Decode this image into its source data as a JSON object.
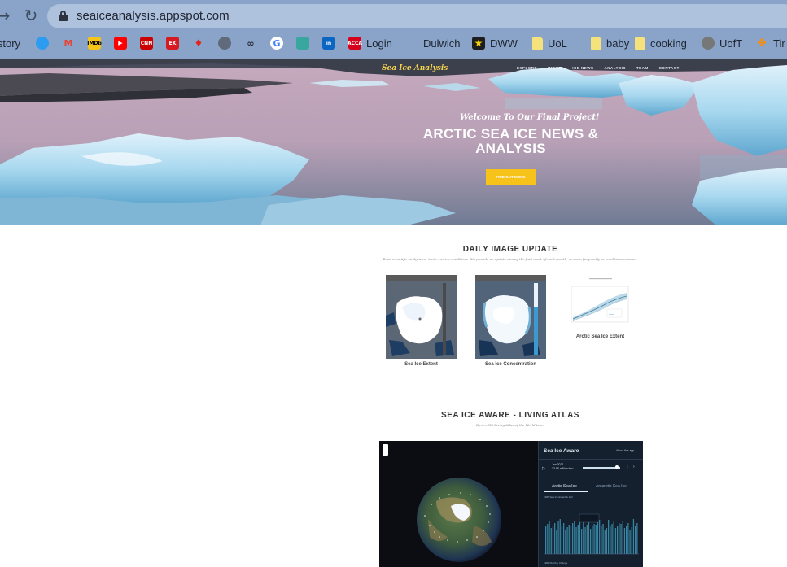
{
  "browser": {
    "url": "seaiceanalysis.appspot.com",
    "bookmarks": [
      {
        "label": "istory",
        "icon": "history-icon"
      },
      {
        "label": "",
        "icon": "circle-icon",
        "color": "#2d9cf0"
      },
      {
        "label": "",
        "icon": "gmail-icon",
        "color": "#e94235"
      },
      {
        "label": "",
        "icon": "imdb-icon",
        "color": "#f5c518",
        "text": "IMDb"
      },
      {
        "label": "",
        "icon": "youtube-icon",
        "color": "#ff0000"
      },
      {
        "label": "",
        "icon": "cnn-icon",
        "color": "#cc0000",
        "text": "CNN"
      },
      {
        "label": "",
        "icon": "ek-icon",
        "color": "#d71921",
        "text": "EK"
      },
      {
        "label": "",
        "icon": "flame-icon",
        "color": "#e2231a"
      },
      {
        "label": "",
        "icon": "globe-icon",
        "color": "#5f6b7a"
      },
      {
        "label": "",
        "icon": "tripadvisor-icon",
        "color": "#1f2430"
      },
      {
        "label": "",
        "icon": "google-icon",
        "color": "#4285f4"
      },
      {
        "label": "",
        "icon": "pattern-icon",
        "color": "#3aa6a0"
      },
      {
        "label": "",
        "icon": "linkedin-icon",
        "color": "#0a66c2",
        "text": "in"
      },
      {
        "label": "Login",
        "icon": "acca-icon",
        "color": "#d6001c",
        "text": "ACCA"
      },
      {
        "label": "Dulwich",
        "icon": "none"
      },
      {
        "label": "DWW",
        "icon": "star-icon"
      },
      {
        "label": "UoL",
        "icon": "folder-icon"
      },
      {
        "label": "baby",
        "icon": "folder-icon"
      },
      {
        "label": "cooking",
        "icon": "folder-icon"
      },
      {
        "label": "UofT",
        "icon": "globe-icon"
      },
      {
        "label": "Tir",
        "icon": "tf-icon"
      }
    ]
  },
  "hero": {
    "brand": "Sea Ice Analysis",
    "nav": [
      "EXPLORE",
      "IMAGE",
      "ICE NEWS",
      "ANALYSIS",
      "TEAM",
      "CONTACT"
    ],
    "welcome": "Welcome To Our Final Project!",
    "headline": "ARCTIC SEA ICE NEWS & ANALYSIS",
    "cta": "FIND OUT MORE"
  },
  "daily": {
    "title": "DAILY IMAGE UPDATE",
    "subtitle": "Read scientific analysis on Arctic sea ice conditions. We provide an update during the first week of each month, or more frequently as conditions warrant.",
    "cards": [
      {
        "caption": "Sea Ice Extent",
        "header": "Sea Ice Extent, 20 Feb 2021"
      },
      {
        "caption": "Sea Ice Concentration",
        "header": "Sea Ice Concentration, 20 Feb 2021"
      },
      {
        "caption": "Arctic Sea Ice Extent",
        "header": "Arctic Sea Ice Extent"
      }
    ]
  },
  "atlas": {
    "title": "SEA ICE AWARE - LIVING ATLAS",
    "subtitle": "By ArcGIS Living Atlas of the World team",
    "panel_title": "Sea Ice Aware",
    "about": "About this app",
    "date_line1": "Jan 2021",
    "date_line2": "13.88 million km²",
    "tabs": [
      "Arctic Sea Ice",
      "Antarctic Sea Ice"
    ],
    "chart_label": "1980 Sea Ice Extent in km²",
    "bottom_label": "1980 Monthly Change"
  }
}
